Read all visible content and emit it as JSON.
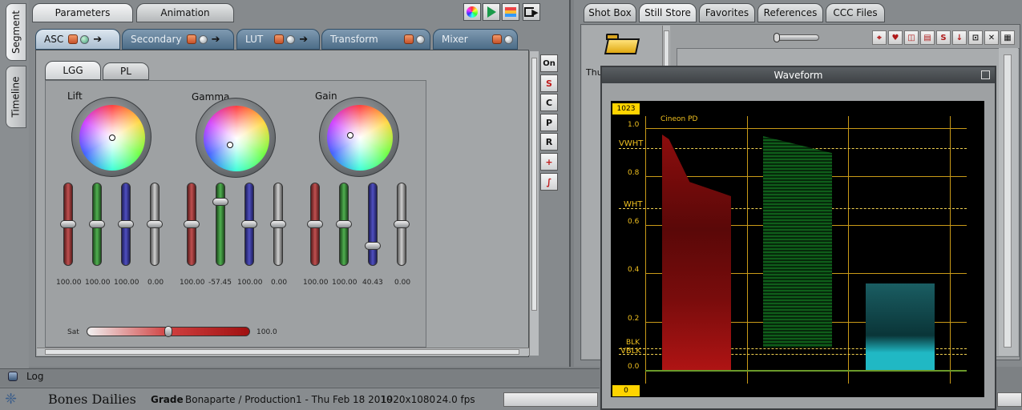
{
  "sidebar": {
    "tabs": [
      {
        "label": "Segment",
        "active": true
      },
      {
        "label": "Timeline",
        "active": false
      }
    ]
  },
  "left_panel": {
    "main_tabs": [
      {
        "label": "Parameters"
      },
      {
        "label": "Animation"
      }
    ],
    "toolbar_icons": [
      "color-wheel-icon",
      "play-icon",
      "layers-icon",
      "export-icon"
    ],
    "sub_tabs": [
      {
        "label": "ASC"
      },
      {
        "label": "Secondary"
      },
      {
        "label": "LUT"
      },
      {
        "label": "Transform"
      },
      {
        "label": "Mixer"
      }
    ],
    "inner_tabs": [
      {
        "label": "LGG"
      },
      {
        "label": "PL"
      }
    ],
    "wheels": [
      {
        "label": "Lift",
        "values": [
          "100.00",
          "100.00",
          "100.00",
          "0.00"
        ]
      },
      {
        "label": "Gamma",
        "values": [
          "100.00",
          "-57.45",
          "100.00",
          "0.00"
        ]
      },
      {
        "label": "Gain",
        "values": [
          "100.00",
          "100.00",
          "40.43",
          "0.00"
        ]
      }
    ],
    "sat": {
      "label": "Sat",
      "value": "100.0"
    },
    "right_tools": [
      "On",
      "S",
      "C",
      "P",
      "R",
      "+",
      ""
    ]
  },
  "right_panel": {
    "tabs": [
      {
        "label": "Shot Box"
      },
      {
        "label": "Still Store"
      },
      {
        "label": "Favorites"
      },
      {
        "label": "References"
      },
      {
        "label": "CCC Files"
      }
    ],
    "thumb_label": "Thu"
  },
  "waveform": {
    "title": "Waveform",
    "top_badge": "1023",
    "bottom_badge": "0",
    "mode": "Cineon PD",
    "levels": {
      "l10": "1.0",
      "vwht": "VWHT",
      "l08": "0.8",
      "wht": "WHT",
      "l06": "0.6",
      "l04": "0.4",
      "l02": "0.2",
      "blk": "BLK",
      "vblk": "VBLK",
      "l00": "0.0"
    }
  },
  "status": {
    "log_label": "Log",
    "app_name": "Bones Dailies",
    "mode": "Grade",
    "project": "Bonaparte / Production1 - Thu Feb 18 2010",
    "resolution": "1920x1080",
    "fps": "24.0 fps"
  }
}
